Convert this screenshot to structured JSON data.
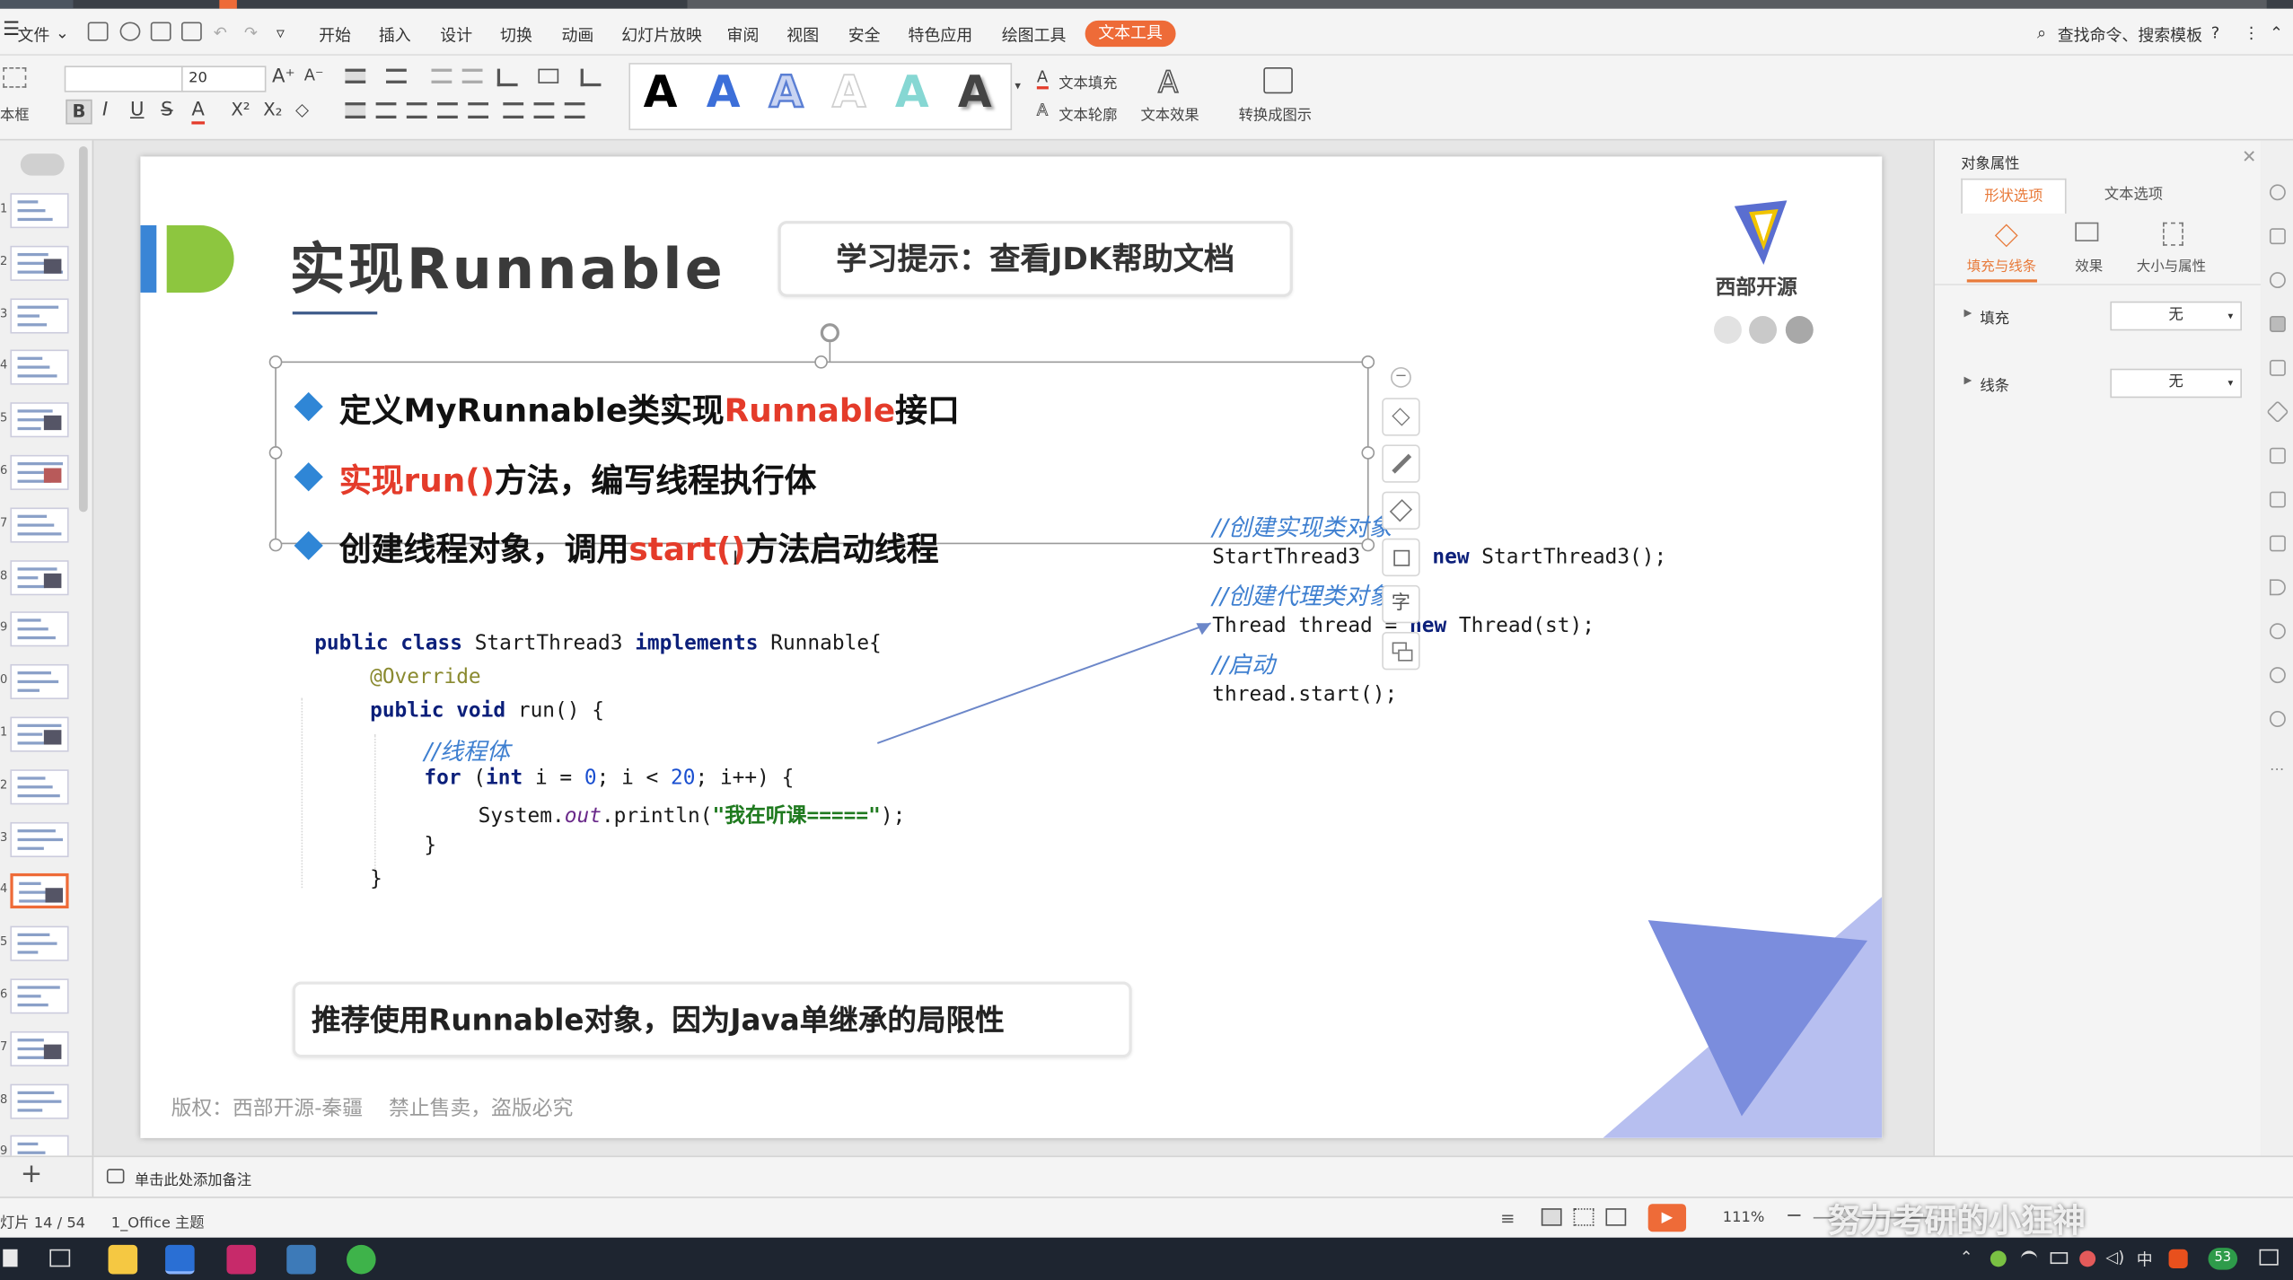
{
  "menu": {
    "file": "文件",
    "tabs": [
      "开始",
      "插入",
      "设计",
      "切换",
      "动画",
      "幻灯片放映",
      "审阅",
      "视图",
      "安全",
      "特色应用",
      "绘图工具",
      "文本工具"
    ],
    "active_tab": "文本工具",
    "search": "查找命令、搜索模板"
  },
  "ribbon": {
    "font_size": "20",
    "textbox_label": "本框",
    "text_fill": "文本填充",
    "text_outline": "文本轮廓",
    "text_effect": "文本效果",
    "convert": "转换成图示",
    "style_glyph": "A"
  },
  "slide": {
    "title": "实现Runnable",
    "tip": "学习提示：查看JDK帮助文档",
    "logo_text": "西部开源",
    "bullets": [
      {
        "parts": [
          {
            "t": "定义MyRunnable类实现",
            "red": false
          },
          {
            "t": "Runnable",
            "red": true
          },
          {
            "t": "接口",
            "red": false
          }
        ]
      },
      {
        "parts": [
          {
            "t": "实现run()",
            "red": true
          },
          {
            "t": "方法，编写线程执行体",
            "red": false
          }
        ]
      },
      {
        "parts": [
          {
            "t": "创建线程对象，调用",
            "red": false
          },
          {
            "t": "start()",
            "red": true
          },
          {
            "t": "方法启动线程",
            "red": false
          }
        ]
      }
    ],
    "code_left": {
      "l1_kw1": "public class",
      "l1_name": " StartThread3 ",
      "l1_kw2": "implements",
      "l1_rest": " Runnable{",
      "l2": "@Override",
      "l3_kw": "public void",
      "l3_rest": " run() {",
      "l4": "//线程体",
      "l5_kw1": "for",
      "l5_a": " (",
      "l5_kw2": "int",
      "l5_b": " i = ",
      "l5_n0": "0",
      "l5_c": "; i < ",
      "l5_n1": "20",
      "l5_d": "; i++) {",
      "l6_a": "System.",
      "l6_out": "out",
      "l6_b": ".println(",
      "l6_str": "\"我在听课=====\"",
      "l6_c": ");",
      "l7": "}",
      "l8": "}"
    },
    "code_right": {
      "c1": "//创建实现类对象",
      "l2_a": "StartThread3",
      "l2_b": " = ",
      "l2_kw": "new",
      "l2_c": " StartThread3();",
      "c3": "//创建代理类对象",
      "l4_a": "Thread thread",
      "l4_b": " = ",
      "l4_kw": "new",
      "l4_c": " Thread(st);",
      "c5": "//启动",
      "l6": "thread.start();"
    },
    "recommend": "推荐使用Runnable对象，因为Java单继承的局限性",
    "copyright": "版权：西部开源-秦疆    禁止售卖，盗版必究",
    "float_text_btn": "字"
  },
  "right_panel": {
    "title": "对象属性",
    "tabs": [
      "形状选项",
      "文本选项"
    ],
    "subtabs": [
      "填充与线条",
      "效果",
      "大小与属性"
    ],
    "fill_label": "填充",
    "fill_value": "无",
    "line_label": "线条",
    "line_value": "无"
  },
  "notes": {
    "placeholder": "单击此处添加备注"
  },
  "status": {
    "slide_info": "灯片 14 / 54",
    "theme": "1_Office 主题",
    "zoom": "111%",
    "watermark": "努力考研的小狂神"
  },
  "thumbnails": {
    "numbers": [
      "1",
      "2",
      "3",
      "4",
      "5",
      "6",
      "7",
      "8",
      "9",
      "0",
      "1",
      "2",
      "3",
      "4",
      "5",
      "6",
      "7",
      "8",
      "9"
    ],
    "selected_index": 13
  },
  "taskbar": {
    "ime": "中",
    "badge": "53"
  },
  "colors": {
    "accent": "#ee6b38",
    "bullet": "#2f86d6",
    "red": "#e43b2a",
    "title_bar": "#8dc63f",
    "logo_blue": "#7a8ad8"
  }
}
